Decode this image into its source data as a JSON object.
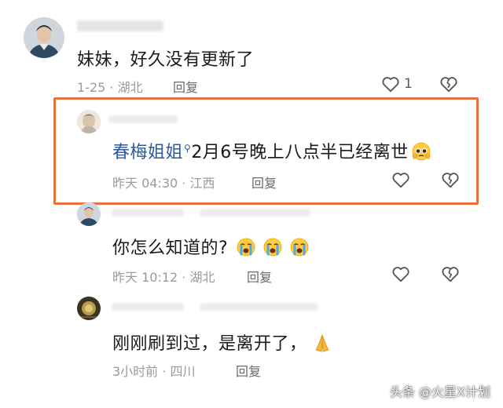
{
  "comments": [
    {
      "text": "妹妹，好久没有更新了",
      "meta": "1-25 · 湖北",
      "reply_label": "回复",
      "like_count": "1"
    },
    {
      "mention": "春梅姐姐",
      "text": "2月6号晚上八点半已经离世",
      "meta": "昨天 04:30 · 江西",
      "reply_label": "回复"
    },
    {
      "text": "你怎么知道的?",
      "meta": "昨天 10:12 · 湖北",
      "reply_label": "回复"
    },
    {
      "text": "刚刚刷到过，是离开了，",
      "meta": "3小时前 · 四川",
      "reply_label": "回复"
    }
  ],
  "highlight_color": "#e8703a",
  "mention_color": "#2b5a9e",
  "icons": [
    "heart-outline-icon",
    "broken-heart-icon",
    "search-mark-icon",
    "crying-emoji-icon",
    "praying-hands-emoji-icon",
    "pleading-emoji-icon"
  ],
  "watermark": "头条 @火星X计划"
}
